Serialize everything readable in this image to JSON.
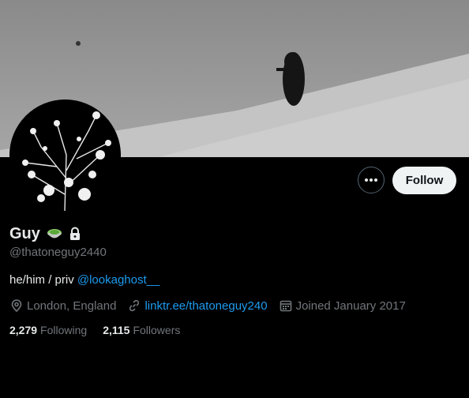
{
  "profile": {
    "display_name": "Guy",
    "name_emoji": "green-bowl-emoji",
    "protected_icon": "lock-icon",
    "handle": "@thatoneguy2440",
    "bio_text": "he/him / priv ",
    "bio_mention": "@lookaghost__",
    "location": "London, England",
    "website": "linktr.ee/thatoneguy240",
    "joined": "Joined January 2017",
    "following_count": "2,279",
    "following_label": "Following",
    "followers_count": "2,115",
    "followers_label": "Followers"
  },
  "actions": {
    "follow_label": "Follow",
    "more_icon": "more-icon"
  },
  "colors": {
    "background": "#000000",
    "accent": "#1d9bf0",
    "muted": "#71767b",
    "text": "#e7e9ea",
    "follow_bg": "#eff3f4"
  }
}
